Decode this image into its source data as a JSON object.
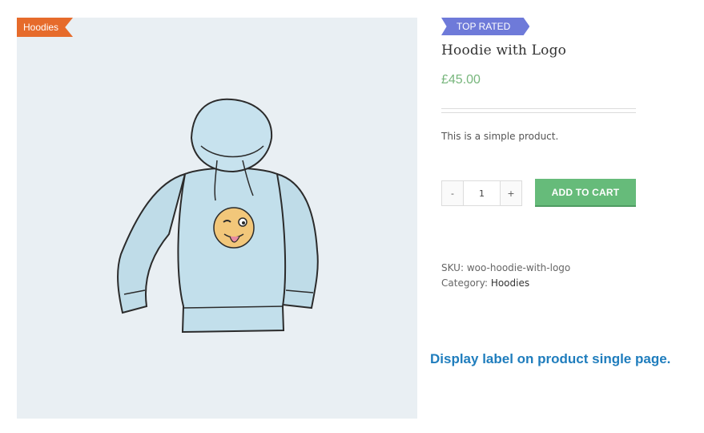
{
  "product": {
    "category_label": "Hoodies",
    "badge": "TOP RATED",
    "title": "Hoodie with Logo",
    "price": "£45.00",
    "short_description": "This is a simple product.",
    "quantity": {
      "decrement": "-",
      "value": "1",
      "increment": "+"
    },
    "add_to_cart": "ADD TO CART",
    "sku_label": "SKU:",
    "sku": "woo-hoodie-with-logo",
    "category_meta_label": "Category:",
    "category_link": "Hoodies"
  },
  "caption": "Display label on product single page.",
  "colors": {
    "category_ribbon": "#e66b2b",
    "badge_ribbon": "#6e7ad9",
    "price": "#77b67c",
    "add_to_cart": "#66bb7a",
    "caption": "#1f7dbd",
    "image_background": "#e9eff3"
  }
}
